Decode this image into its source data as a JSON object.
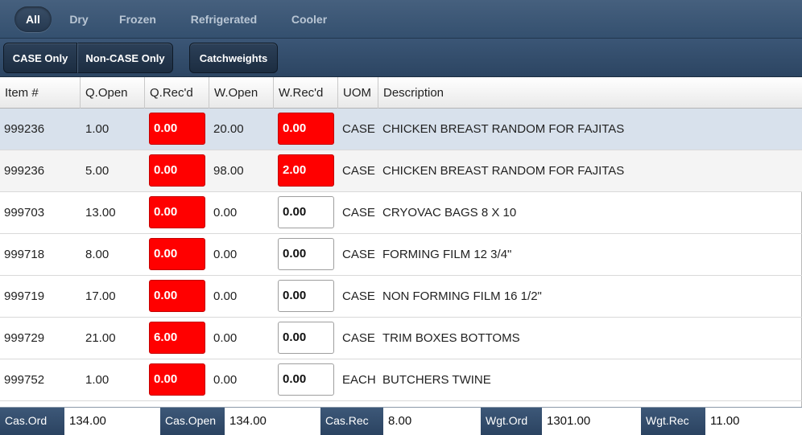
{
  "tabs": [
    {
      "label": "All",
      "active": true
    },
    {
      "label": "Dry",
      "active": false
    },
    {
      "label": "Frozen",
      "active": false
    },
    {
      "label": "Refrigerated",
      "active": false
    },
    {
      "label": "Cooler",
      "active": false
    }
  ],
  "filters": {
    "case_only": "CASE Only",
    "non_case_only": "Non-CASE Only",
    "catchweights": "Catchweights"
  },
  "columns": [
    "Item #",
    "Q.Open",
    "Q.Rec'd",
    "W.Open",
    "W.Rec'd",
    "UOM",
    "Description"
  ],
  "rows": [
    {
      "item": "999236",
      "q_open": "1.00",
      "q_recd": "0.00",
      "w_open": "20.00",
      "w_recd": "0.00",
      "uom": "CASE",
      "description": "CHICKEN BREAST RANDOM FOR FAJITAS",
      "q_recd_flag": "red",
      "w_recd_flag": "red"
    },
    {
      "item": "999236",
      "q_open": "5.00",
      "q_recd": "0.00",
      "w_open": "98.00",
      "w_recd": "2.00",
      "uom": "CASE",
      "description": "CHICKEN BREAST RANDOM FOR FAJITAS",
      "q_recd_flag": "red",
      "w_recd_flag": "red"
    },
    {
      "item": "999703",
      "q_open": "13.00",
      "q_recd": "0.00",
      "w_open": "0.00",
      "w_recd": "0.00",
      "uom": "CASE",
      "description": "CRYOVAC BAGS 8 X 10",
      "q_recd_flag": "red",
      "w_recd_flag": "white"
    },
    {
      "item": "999718",
      "q_open": "8.00",
      "q_recd": "0.00",
      "w_open": "0.00",
      "w_recd": "0.00",
      "uom": "CASE",
      "description": "FORMING FILM 12 3/4\"",
      "q_recd_flag": "red",
      "w_recd_flag": "white"
    },
    {
      "item": "999719",
      "q_open": "17.00",
      "q_recd": "0.00",
      "w_open": "0.00",
      "w_recd": "0.00",
      "uom": "CASE",
      "description": "NON FORMING FILM 16 1/2\"",
      "q_recd_flag": "red",
      "w_recd_flag": "white"
    },
    {
      "item": "999729",
      "q_open": "21.00",
      "q_recd": "6.00",
      "w_open": "0.00",
      "w_recd": "0.00",
      "uom": "CASE",
      "description": "TRIM BOXES BOTTOMS",
      "q_recd_flag": "red",
      "w_recd_flag": "white"
    },
    {
      "item": "999752",
      "q_open": "1.00",
      "q_recd": "0.00",
      "w_open": "0.00",
      "w_recd": "0.00",
      "uom": "EACH",
      "description": "BUTCHERS TWINE",
      "q_recd_flag": "red",
      "w_recd_flag": "white"
    }
  ],
  "footer": {
    "cas_ord_label": "Cas.Ord",
    "cas_ord_value": "134.00",
    "cas_open_label": "Cas.Open",
    "cas_open_value": "134.00",
    "cas_rec_label": "Cas.Rec",
    "cas_rec_value": "8.00",
    "wgt_ord_label": "Wgt.Ord",
    "wgt_ord_value": "1301.00",
    "wgt_rec_label": "Wgt.Rec",
    "wgt_rec_value": "11.00"
  },
  "colors": {
    "flag_red": "#ff0000",
    "toolbar": "#34506f",
    "selected_row": "#d8e1ec"
  }
}
